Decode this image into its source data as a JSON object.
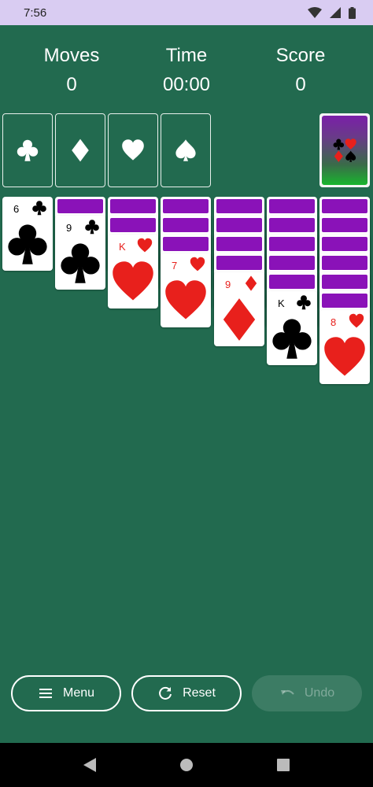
{
  "status_bar": {
    "time": "7:56"
  },
  "stats": {
    "moves_label": "Moves",
    "moves_value": "0",
    "time_label": "Time",
    "time_value": "00:00",
    "score_label": "Score",
    "score_value": "0"
  },
  "foundations": [
    "club-icon",
    "diamond-icon",
    "heart-icon",
    "spade-icon"
  ],
  "tableau": [
    {
      "face_down": 0,
      "face_up": {
        "rank": "6",
        "suit": "clubs",
        "color": "black"
      }
    },
    {
      "face_down": 1,
      "face_up": {
        "rank": "9",
        "suit": "clubs",
        "color": "black"
      }
    },
    {
      "face_down": 2,
      "face_up": {
        "rank": "K",
        "suit": "hearts",
        "color": "red"
      }
    },
    {
      "face_down": 3,
      "face_up": {
        "rank": "7",
        "suit": "hearts",
        "color": "red"
      }
    },
    {
      "face_down": 4,
      "face_up": {
        "rank": "9",
        "suit": "diamonds",
        "color": "red"
      }
    },
    {
      "face_down": 5,
      "face_up": {
        "rank": "K",
        "suit": "clubs",
        "color": "black"
      }
    },
    {
      "face_down": 6,
      "face_up": {
        "rank": "8",
        "suit": "hearts",
        "color": "red"
      }
    }
  ],
  "buttons": {
    "menu_label": "Menu",
    "reset_label": "Reset",
    "undo_label": "Undo"
  },
  "colors": {
    "table_green": "#226a4f",
    "card_back_purple": "#8a12b8",
    "red_suit": "#e8201c",
    "status_bar": "#d9ccf2"
  }
}
